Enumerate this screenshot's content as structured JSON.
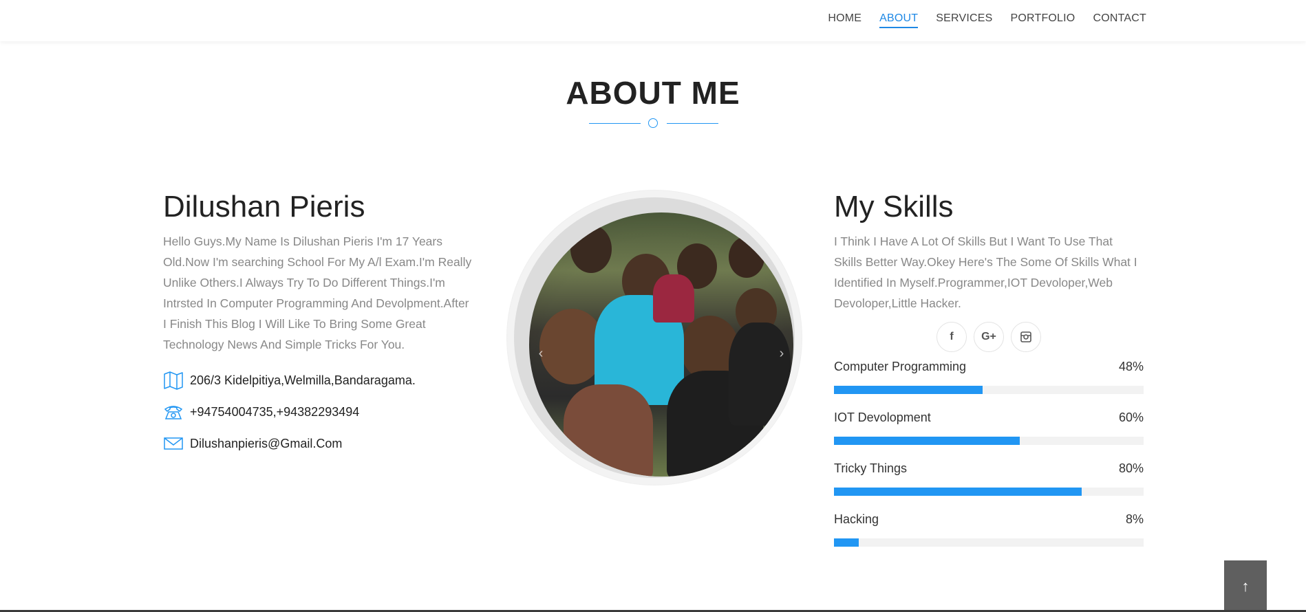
{
  "nav": {
    "items": [
      {
        "label": "HOME",
        "active": false
      },
      {
        "label": "ABOUT",
        "active": true
      },
      {
        "label": "SERVICES",
        "active": false
      },
      {
        "label": "PORTFOLIO",
        "active": false
      },
      {
        "label": "CONTACT",
        "active": false
      }
    ]
  },
  "section": {
    "title": "ABOUT ME"
  },
  "about": {
    "name": "Dilushan Pieris",
    "bio": "Hello Guys.My Name Is Dilushan Pieris I'm 17 Years Old.Now I'm searching School For My A/l Exam.I'm Really Unlike Others.I Always Try To Do Different Things.I'm Intrsted In Computer Programming And Devolpment.After I Finish This Blog I Will Like To Bring Some Great Technology News And Simple Tricks For You.",
    "contacts": [
      {
        "icon": "map-icon",
        "text": "206/3 Kidelpitiya,Welmilla,Bandaragama."
      },
      {
        "icon": "phone-icon",
        "text": "+94754004735,+94382293494"
      },
      {
        "icon": "mail-icon",
        "text": "Dilushanpieris@Gmail.Com"
      }
    ]
  },
  "slider": {
    "dot_count": 5,
    "active_dot": 1
  },
  "skills": {
    "heading": "My Skills",
    "intro": "I Think I Have A Lot Of Skills But I Want To Use That Skills Better Way.Okey Here's The Some Of Skills What I Identified In Myself.Programmer,IOT Devoloper,Web Devoloper,Little Hacker.",
    "social": [
      {
        "icon": "facebook-icon",
        "glyph": "f"
      },
      {
        "icon": "google-plus-icon",
        "glyph": "G+"
      },
      {
        "icon": "instagram-icon",
        "glyph": ""
      }
    ],
    "items": [
      {
        "name": "Computer Programming",
        "percent_label": "48%",
        "value": 48
      },
      {
        "name": "IOT Devolopment",
        "percent_label": "60%",
        "value": 60
      },
      {
        "name": "Tricky Things",
        "percent_label": "80%",
        "value": 80
      },
      {
        "name": "Hacking",
        "percent_label": "8%",
        "value": 8
      }
    ]
  },
  "colors": {
    "accent": "#2196f3",
    "nav_text": "#444444",
    "bio_text": "#888888"
  }
}
